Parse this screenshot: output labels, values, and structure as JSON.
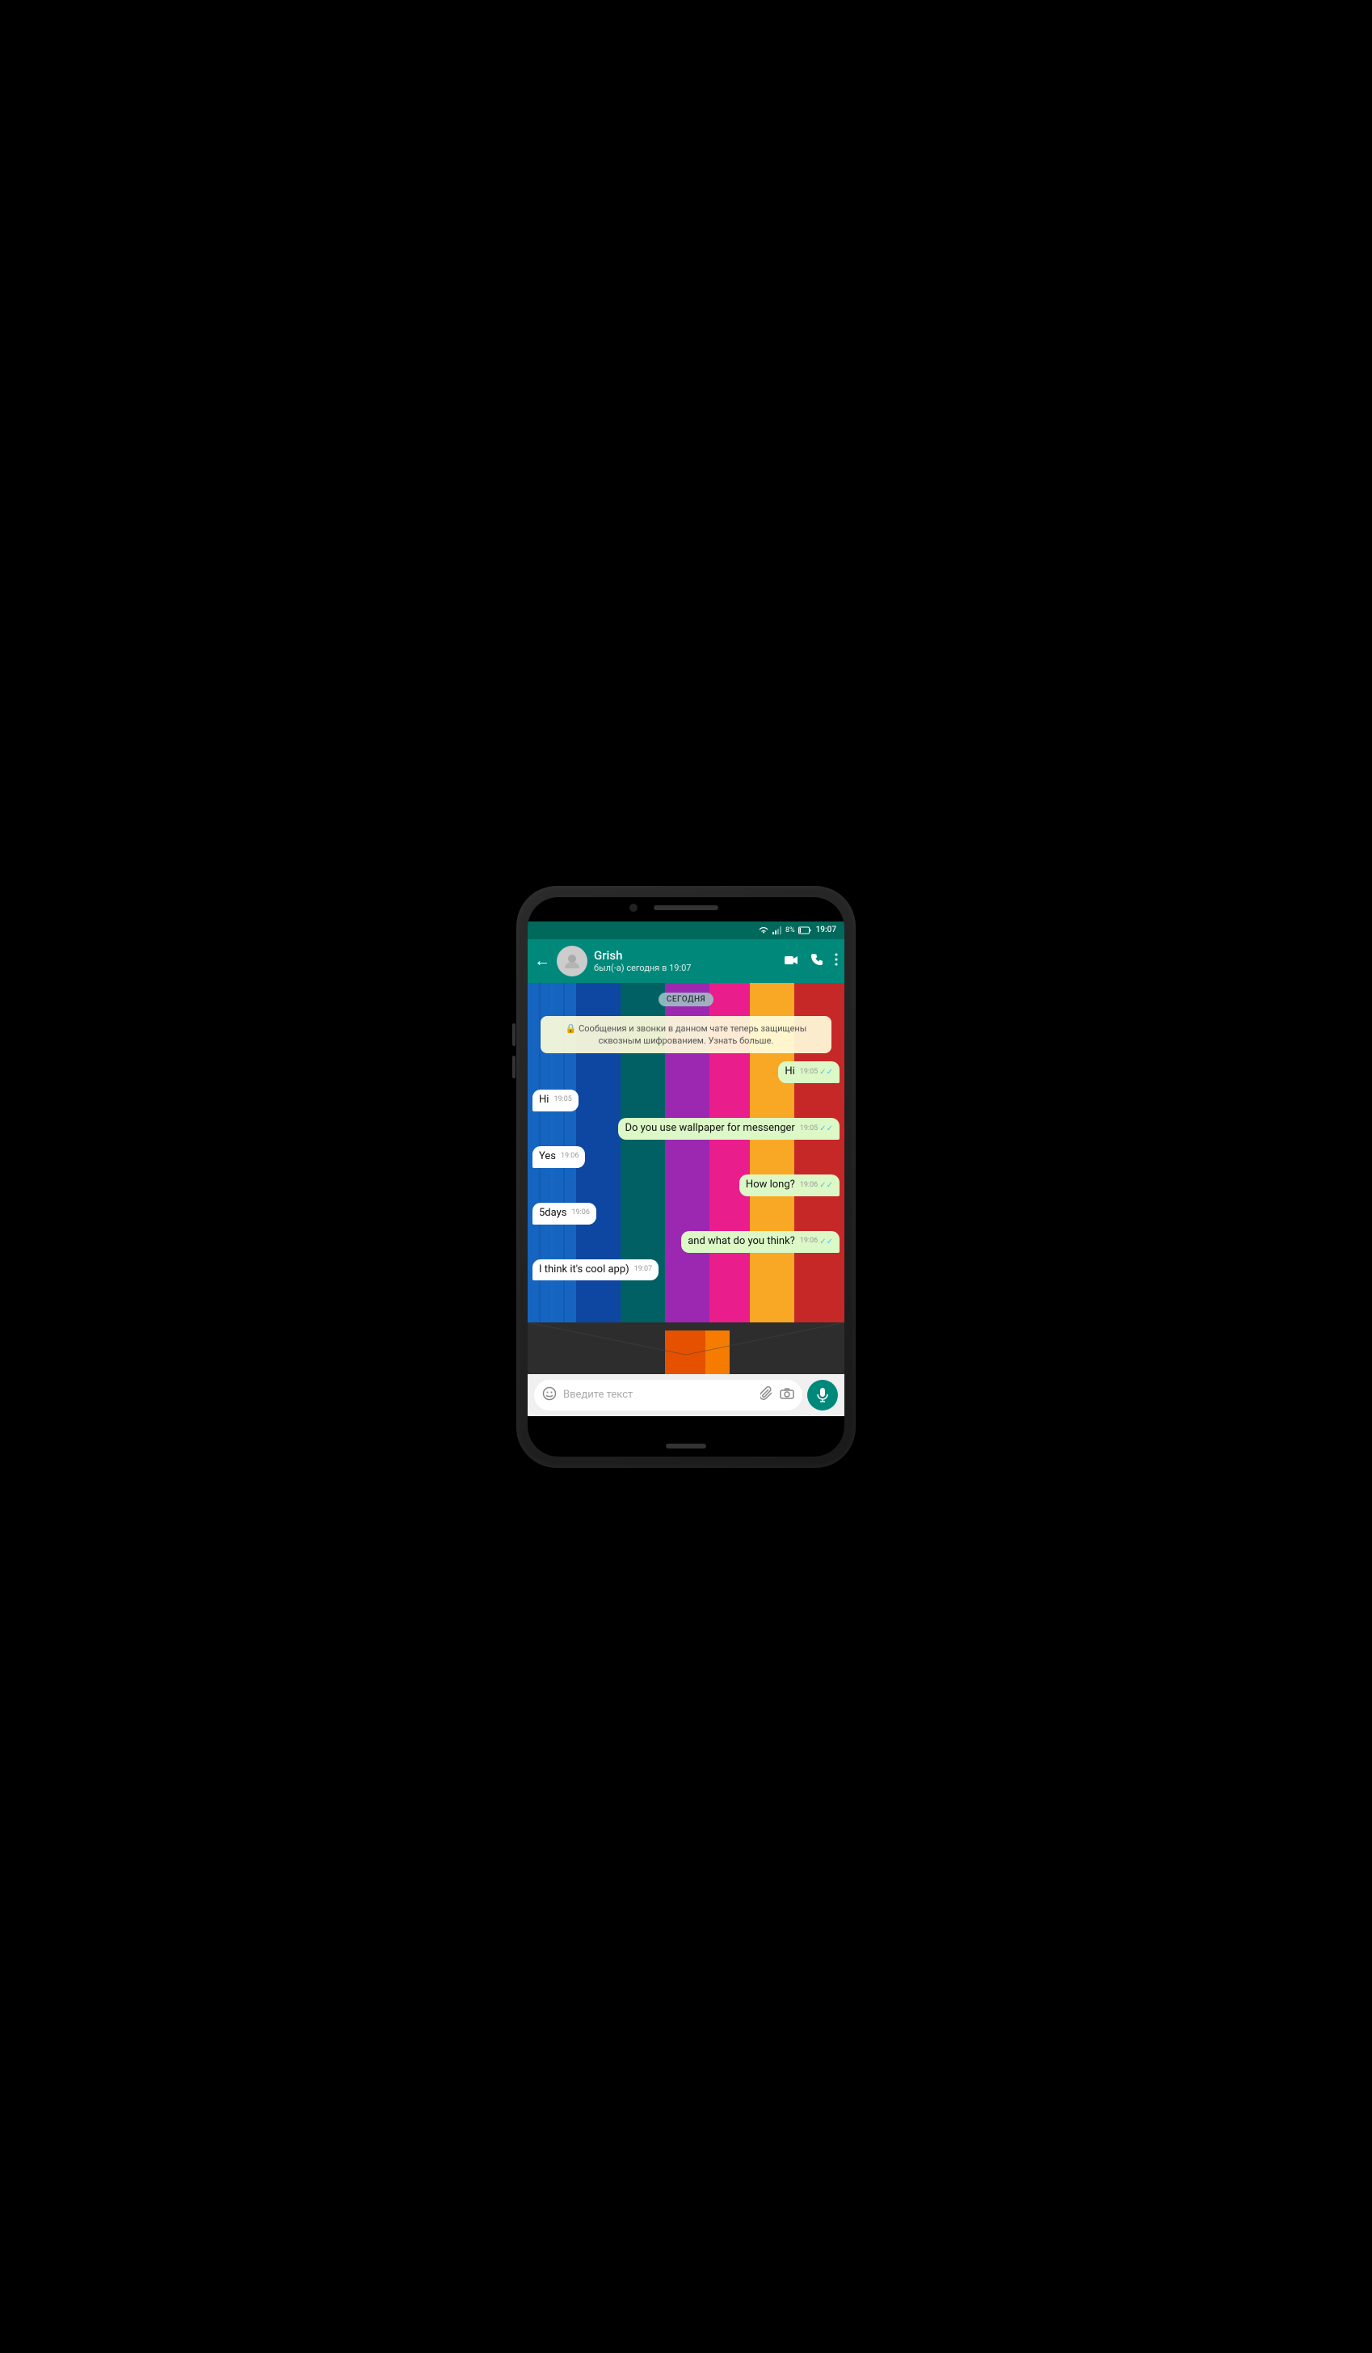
{
  "status_bar": {
    "wifi_icon": "wifi",
    "signal_icon": "signal",
    "battery": "8%",
    "time": "19:07"
  },
  "header": {
    "back_label": "←",
    "contact_name": "Grish",
    "contact_status": "был(-а) сегодня в 19:07",
    "video_icon": "video-camera",
    "phone_icon": "phone",
    "more_icon": "more-vertical"
  },
  "chat": {
    "date_badge": "СЕГОДНЯ",
    "encryption_notice": "🔒 Сообщения и звонки в данном чате теперь защищены сквозным шифрованием. Узнать больше.",
    "messages": [
      {
        "id": 1,
        "type": "sent",
        "text": "Hi",
        "time": "19:05",
        "ticks": "✓✓"
      },
      {
        "id": 2,
        "type": "received",
        "text": "Hi",
        "time": "19:05"
      },
      {
        "id": 3,
        "type": "sent",
        "text": "Do you use wallpaper for messenger",
        "time": "19:05",
        "ticks": "✓✓"
      },
      {
        "id": 4,
        "type": "received",
        "text": "Yes",
        "time": "19:06"
      },
      {
        "id": 5,
        "type": "sent",
        "text": "How long?",
        "time": "19:06",
        "ticks": "✓✓"
      },
      {
        "id": 6,
        "type": "received",
        "text": "5days",
        "time": "19:06"
      },
      {
        "id": 7,
        "type": "sent",
        "text": "and what do you think?",
        "time": "19:06",
        "ticks": "✓✓"
      },
      {
        "id": 8,
        "type": "received",
        "text": "I think it's cool app)",
        "time": "19:07"
      }
    ]
  },
  "bottom_bar": {
    "emoji_icon": "emoji",
    "placeholder": "Введите текст",
    "attachment_icon": "paperclip",
    "camera_icon": "camera",
    "mic_icon": "mic"
  }
}
